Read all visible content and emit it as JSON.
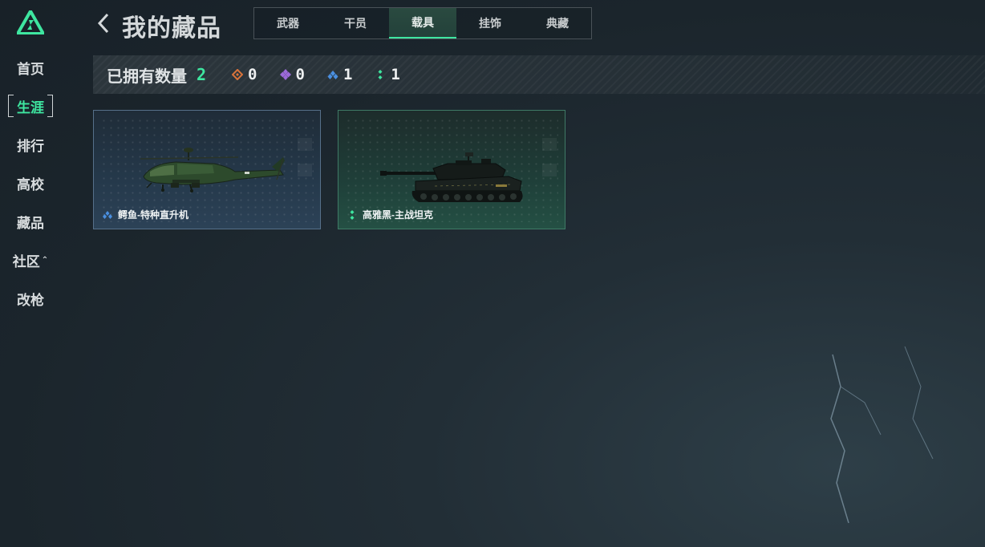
{
  "sidebar": {
    "items": [
      {
        "label": "首页"
      },
      {
        "label": "生涯"
      },
      {
        "label": "排行"
      },
      {
        "label": "高校"
      },
      {
        "label": "藏品"
      },
      {
        "label": "社区"
      },
      {
        "label": "改枪"
      }
    ],
    "active_label": "生涯",
    "accent": "#3ee6a0"
  },
  "header": {
    "title": "我的藏品",
    "tabs": [
      {
        "label": "武器"
      },
      {
        "label": "干员"
      },
      {
        "label": "载具"
      },
      {
        "label": "挂饰"
      },
      {
        "label": "典藏"
      }
    ],
    "active_tab": "载具"
  },
  "stats": {
    "label": "已拥有数量",
    "total": "2",
    "rarities": [
      {
        "icon": "orange-diamond-icon",
        "color": "#d9733a",
        "count": "0"
      },
      {
        "icon": "purple-diamond-icon",
        "color": "#9b6ad8",
        "count": "0"
      },
      {
        "icon": "blue-diamond-icon",
        "color": "#4a8fe0",
        "count": "1"
      },
      {
        "icon": "green-dots-icon",
        "color": "#3ee6a0",
        "count": "1"
      }
    ]
  },
  "cards": [
    {
      "name": "鳄鱼-特种直升机",
      "rarity_icon": "blue-diamond-icon",
      "rarity_color": "#4a8fe0"
    },
    {
      "name": "高雅黑-主战坦克",
      "rarity_icon": "green-dots-icon",
      "rarity_color": "#3ee6a0"
    }
  ]
}
